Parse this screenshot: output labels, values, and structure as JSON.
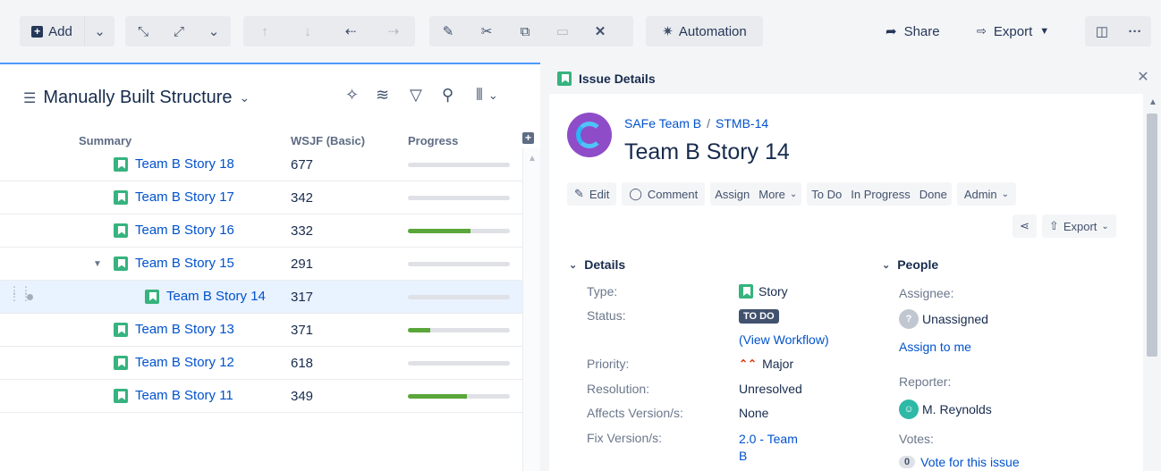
{
  "toolbar": {
    "add_label": "Add",
    "automation_label": "Automation",
    "share_label": "Share",
    "export_label": "Export"
  },
  "structure": {
    "title": "Manually Built Structure",
    "columns": {
      "summary": "Summary",
      "wsjf": "WSJF (Basic)",
      "progress": "Progress"
    },
    "rows": [
      {
        "summary": "Team B Story 18",
        "wsjf": "677",
        "progress": 0
      },
      {
        "summary": "Team B Story 17",
        "wsjf": "342",
        "progress": 0
      },
      {
        "summary": "Team B Story 16",
        "wsjf": "332",
        "progress": 0.61
      },
      {
        "summary": "Team B Story 15",
        "wsjf": "291",
        "progress": 0
      },
      {
        "summary": "Team B Story 14",
        "wsjf": "317",
        "progress": 0
      },
      {
        "summary": "Team B Story 13",
        "wsjf": "371",
        "progress": 0.22
      },
      {
        "summary": "Team B Story 12",
        "wsjf": "618",
        "progress": 0
      },
      {
        "summary": "Team B Story 11",
        "wsjf": "349",
        "progress": 0.58
      }
    ]
  },
  "details_panel": {
    "header": "Issue Details",
    "project": "SAFe Team B",
    "issue_key": "STMB-14",
    "issue_title": "Team B Story 14",
    "actions": {
      "edit": "Edit",
      "comment": "Comment",
      "assign": "Assign",
      "more": "More",
      "todo": "To Do",
      "in_progress": "In Progress",
      "done": "Done",
      "admin": "Admin",
      "export": "Export"
    },
    "details": {
      "section": "Details",
      "type_label": "Type:",
      "type_value": "Story",
      "status_label": "Status:",
      "status_value": "TO DO",
      "view_workflow": "(View Workflow)",
      "priority_label": "Priority:",
      "priority_value": "Major",
      "resolution_label": "Resolution:",
      "resolution_value": "Unresolved",
      "affects_label": "Affects Version/s:",
      "affects_value": "None",
      "fix_label": "Fix Version/s:",
      "fix_value_1": "2.0 - Team",
      "fix_value_2": "B"
    },
    "people": {
      "section": "People",
      "assignee_label": "Assignee:",
      "assignee_value": "Unassigned",
      "assign_to_me": "Assign to me",
      "reporter_label": "Reporter:",
      "reporter_value": "M. Reynolds",
      "votes_label": "Votes:",
      "votes_count": "0",
      "vote_link": "Vote for this issue"
    }
  },
  "colors": {
    "accent": "#0052cc",
    "story_green": "#36b37e",
    "progress_green": "#5aa63a",
    "selected_row": "#e9f2ff"
  }
}
